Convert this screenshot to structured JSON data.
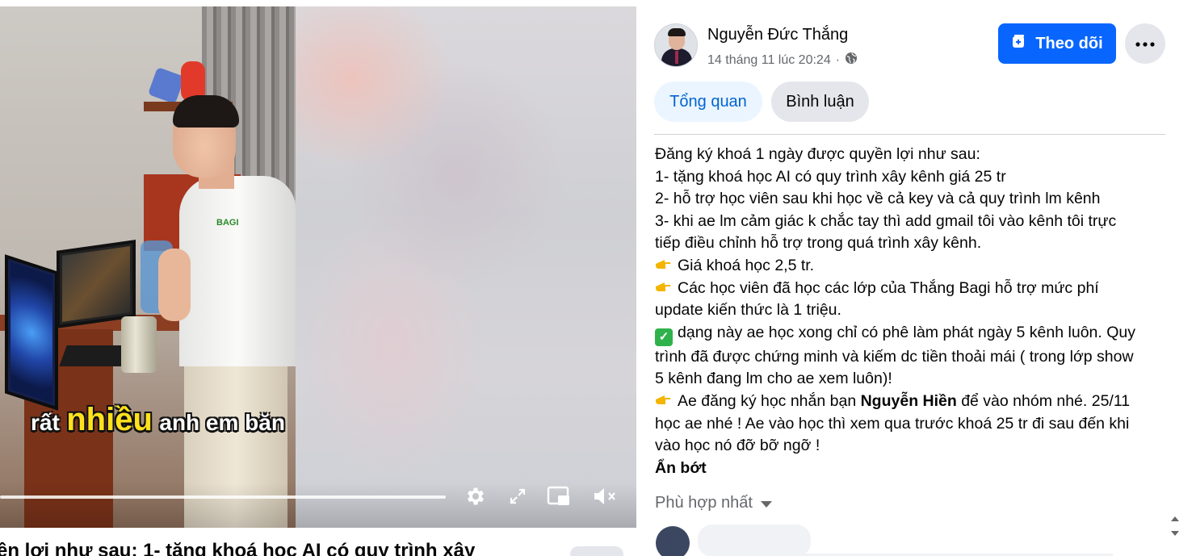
{
  "video": {
    "caption": {
      "part1": "rất",
      "part2": "nhiều",
      "part3": "anh em băn"
    },
    "shirt_logo": "BAGI",
    "controls": {
      "settings": "gear-icon",
      "fullscreen": "expand-icon",
      "pip": "picture-in-picture-icon",
      "mute": "volume-muted-icon"
    },
    "progress": 0.0
  },
  "below_video_title": "ền lợi như sau: 1- tặng khoá học AI có quy trình xây",
  "post": {
    "author": "Nguyễn Đức Thắng",
    "timestamp": "14 tháng 11 lúc 20:24",
    "audience_icon": "globe-icon",
    "follow_label": "Theo dõi",
    "more_icon": "more-dots-icon",
    "tabs": {
      "overview": "Tổng quan",
      "comments": "Bình luận"
    },
    "lines": {
      "l1": "Đăng ký khoá 1 ngày được quyền lợi như sau:",
      "l2": "1- tặng khoá học AI có quy trình xây kênh giá 25 tr",
      "l3": "2- hỗ trợ học viên sau khi học về cả key và cả quy trình lm kênh",
      "l4": "3- khi ae lm cảm giác k chắc tay thì add gmail tôi vào kênh tôi trực",
      "l5": "tiếp điều chỉnh hỗ trợ trong quá trình xây kênh.",
      "l6": "Giá khoá học 2,5 tr.",
      "l7": "Các học viên đã học các lớp của Thắng Bagi hỗ trợ mức phí",
      "l8": "update kiến thức là 1 triệu.",
      "l9": "dạng này ae học xong chỉ có phê làm phát ngày 5 kênh luôn. Quy",
      "l10": "trình đã được chứng minh và kiếm dc tiền thoải mái ( trong lớp show",
      "l11": "5 kênh đang lm cho ae xem luôn)!",
      "l12a": "Ae đăng ký học nhắn bạn ",
      "l12b": "Nguyễn Hiền",
      "l12c": " để vào nhóm nhé. 25/11",
      "l13": "học ae nhé ! Ae vào học thì xem qua trước khoá 25 tr đi sau đến khi",
      "l14": "vào học nó đỡ bỡ ngỡ !"
    },
    "see_less": "Ẩn bớt",
    "sort_label": "Phù hợp nhất"
  },
  "colors": {
    "accent": "#0866ff",
    "tab_active_bg": "#ebf5ff",
    "tab_active_text": "#0064d1",
    "muted_text": "#65676b"
  }
}
